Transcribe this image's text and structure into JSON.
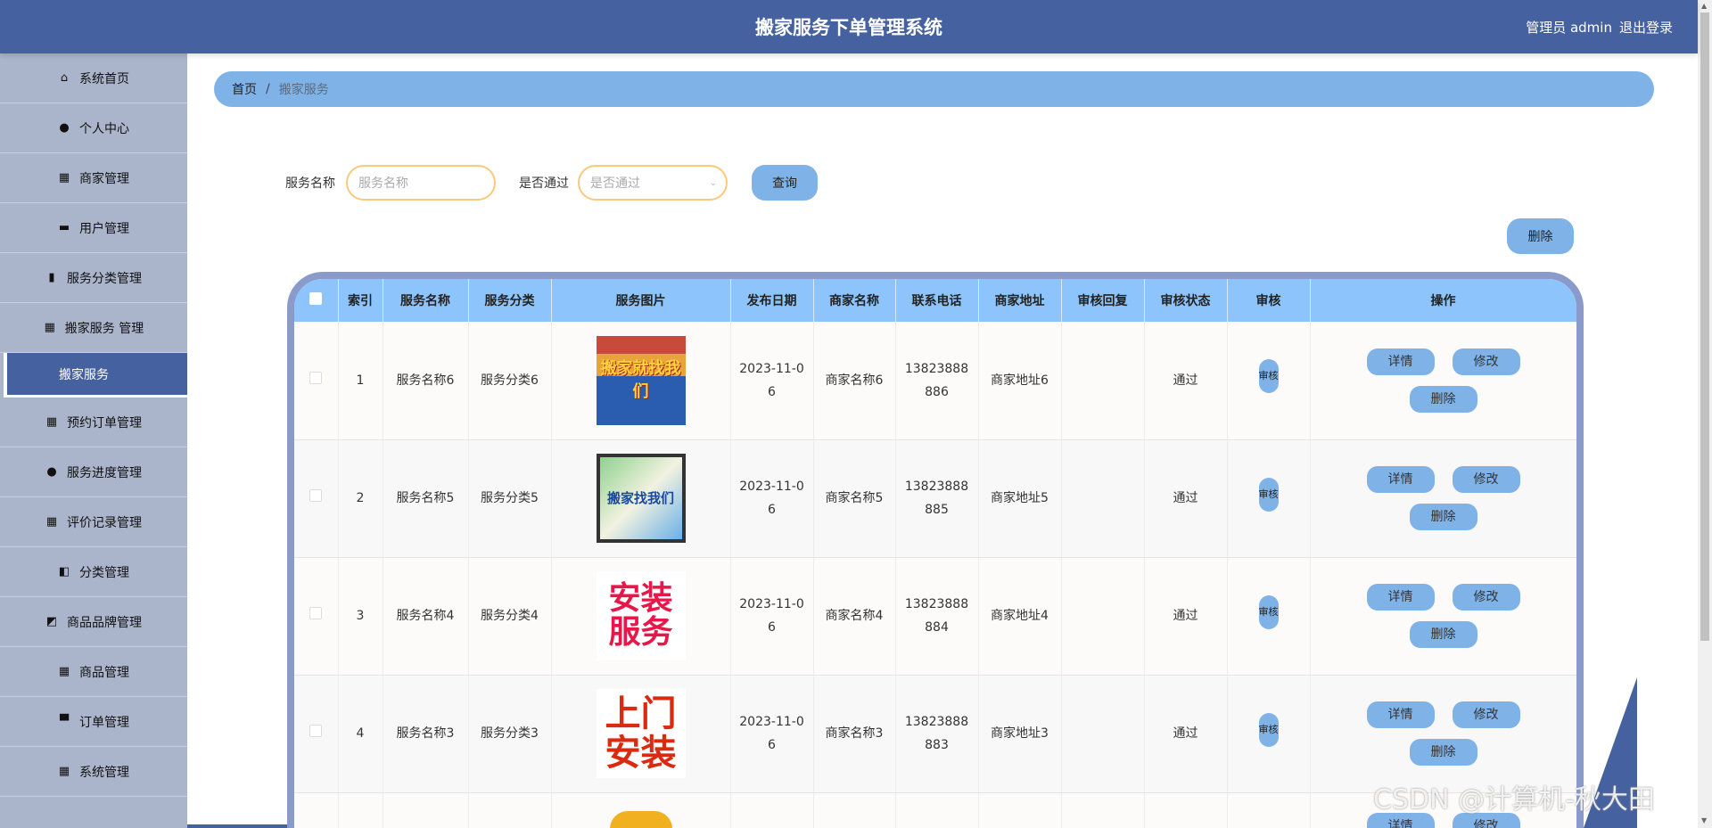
{
  "header": {
    "title": "搬家服务下单管理系统",
    "user": "管理员 admin",
    "logout": "退出登录"
  },
  "sidebar": {
    "items": [
      {
        "label": "系统首页",
        "icon": "home-icon"
      },
      {
        "label": "个人中心",
        "icon": "user-icon"
      },
      {
        "label": "商家管理",
        "icon": "grid-icon"
      },
      {
        "label": "用户管理",
        "icon": "briefcase-icon"
      },
      {
        "label": "服务分类管理",
        "icon": "clipboard-icon"
      },
      {
        "label": "搬家服务 管理",
        "icon": "grid-icon"
      },
      {
        "label": "搬家服务",
        "icon": "",
        "sub": true
      },
      {
        "label": "预约订单管理",
        "icon": "grid-icon"
      },
      {
        "label": "服务进度管理",
        "icon": "bulb-icon"
      },
      {
        "label": "评价记录管理",
        "icon": "grid-icon"
      },
      {
        "label": "分类管理",
        "icon": "wallet-icon"
      },
      {
        "label": "商品品牌管理",
        "icon": "chart-icon"
      },
      {
        "label": "商品管理",
        "icon": "grid-icon"
      },
      {
        "label": "订单管理",
        "icon": "monitor-icon"
      },
      {
        "label": "系统管理",
        "icon": "grid-icon"
      }
    ]
  },
  "breadcrumb": {
    "home": "首页",
    "sep": "/",
    "current": "搬家服务"
  },
  "search": {
    "name_label": "服务名称",
    "name_placeholder": "服务名称",
    "pass_label": "是否通过",
    "pass_placeholder": "是否通过",
    "query": "查询"
  },
  "toolbar": {
    "delete": "删除"
  },
  "table": {
    "headers": [
      "",
      "索引",
      "服务名称",
      "服务分类",
      "服务图片",
      "发布日期",
      "商家名称",
      "联系电话",
      "商家地址",
      "审核回复",
      "审核状态",
      "审核",
      "操作"
    ],
    "rows": [
      {
        "index": "1",
        "name": "服务名称6",
        "category": "服务分类6",
        "pic_text": "搬家就找我们",
        "date": "2023-11-06",
        "merchant": "商家名称6",
        "phone": "13823888886",
        "address": "商家地址6",
        "reply": "",
        "status": "通过",
        "audit": "审核"
      },
      {
        "index": "2",
        "name": "服务名称5",
        "category": "服务分类5",
        "pic_text": "搬家找我们",
        "date": "2023-11-06",
        "merchant": "商家名称5",
        "phone": "13823888885",
        "address": "商家地址5",
        "reply": "",
        "status": "通过",
        "audit": "审核"
      },
      {
        "index": "3",
        "name": "服务名称4",
        "category": "服务分类4",
        "pic_text": "安装服务",
        "date": "2023-11-06",
        "merchant": "商家名称4",
        "phone": "13823888884",
        "address": "商家地址4",
        "reply": "",
        "status": "通过",
        "audit": "审核"
      },
      {
        "index": "4",
        "name": "服务名称3",
        "category": "服务分类3",
        "pic_text": "上门安装",
        "date": "2023-11-06",
        "merchant": "商家名称3",
        "phone": "13823888883",
        "address": "商家地址3",
        "reply": "",
        "status": "通过",
        "audit": "审核"
      }
    ],
    "actions": {
      "detail": "详情",
      "edit": "修改",
      "delete": "删除"
    }
  },
  "watermark": "CSDN @计算机-秋大田",
  "colors": {
    "header": "#4661a0",
    "sidebar": "#aab4ca",
    "accent": "#7fb3e8",
    "table_header": "#8cc4fb",
    "input_border": "#fbc97a"
  }
}
